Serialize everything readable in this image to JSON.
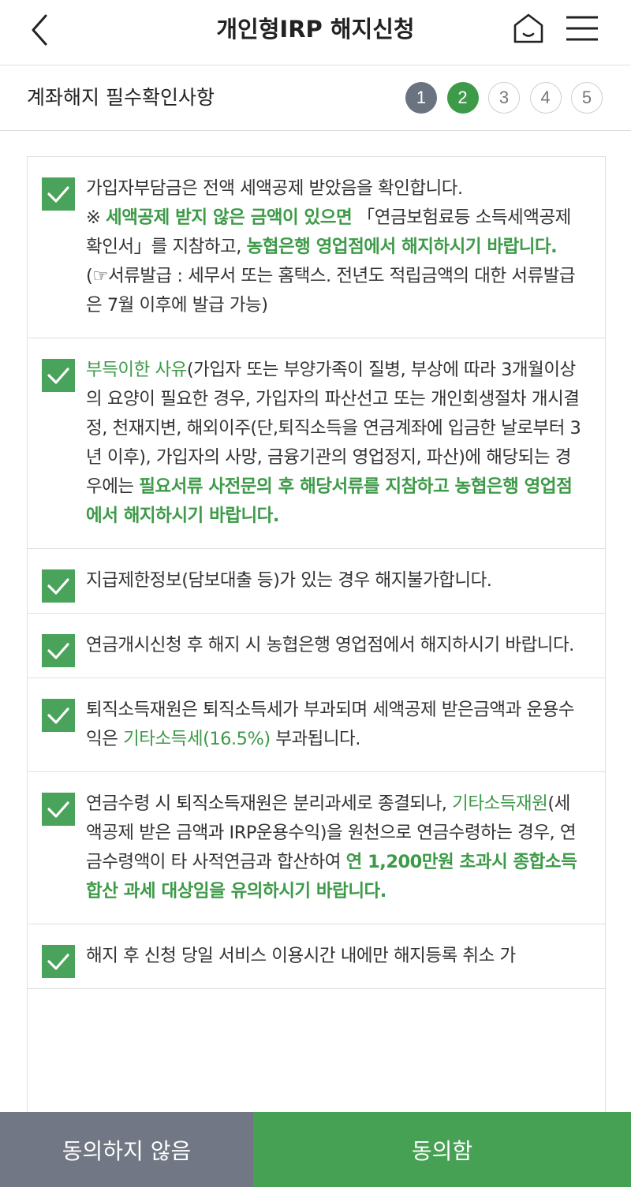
{
  "header": {
    "title": "개인형IRP 해지신청",
    "back_icon": "chevron-left-icon",
    "home_icon": "home-icon",
    "menu_icon": "hamburger-menu-icon"
  },
  "subheader": {
    "title": "계좌해지 필수확인사항",
    "steps": [
      "1",
      "2",
      "3",
      "4",
      "5"
    ],
    "current_step": 2
  },
  "colors": {
    "accent": "#3d9a48",
    "checkbox": "#4aa35a",
    "step_done": "#6b7380",
    "disagree_bg": "#717784",
    "agree_bg": "#46a155"
  },
  "items": [
    {
      "checked": true,
      "segments": [
        {
          "t": "가입자부담금은 전액 세액공제 받았음을 확인합니다."
        },
        {
          "br": true
        },
        {
          "t": "※ "
        },
        {
          "t": "세액공제 받지 않은 금액이 있으면",
          "g": true,
          "b": true
        },
        {
          "t": " 「연금보험료등 소득세액공제확인서」를 지참하고, "
        },
        {
          "t": "농협은행 영업점에서 해지하시기 바랍니다.",
          "g": true,
          "b": true
        },
        {
          "br": true
        },
        {
          "t": "(☞서류발급 : 세무서 또는 홈택스. 전년도 적립금액의 대한 서류발급은 7월 이후에 발급 가능)"
        }
      ]
    },
    {
      "checked": true,
      "segments": [
        {
          "t": "부득이한 사유",
          "g": true
        },
        {
          "t": "(가입자 또는 부양가족이 질병, 부상에 따라 3개월이상의 요양이 필요한 경우, 가입자의 파산선고 또는 개인회생절차 개시결정, 천재지변, 해외이주(단,퇴직소득을 연금계좌에 입금한 날로부터 3년 이후), 가입자의 사망, 금융기관의 영업정지, 파산)에 해당되는 경우에는 "
        },
        {
          "t": "필요서류 사전문의 후 해당서류를 지참하고 농협은행 영업점에서 해지하시기 바랍니다.",
          "g": true,
          "b": true
        }
      ]
    },
    {
      "checked": true,
      "segments": [
        {
          "t": "지급제한정보(담보대출 등)가 있는 경우 해지불가합니다."
        }
      ]
    },
    {
      "checked": true,
      "segments": [
        {
          "t": "연금개시신청 후 해지 시 농협은행 영업점에서 해지하시기 바랍니다."
        }
      ]
    },
    {
      "checked": true,
      "segments": [
        {
          "t": "퇴직소득재원은 퇴직소득세가 부과되며 세액공제 받은금액과 운용수익은 "
        },
        {
          "t": "기타소득세(16.5%)",
          "g": true
        },
        {
          "t": " 부과됩니다."
        }
      ]
    },
    {
      "checked": true,
      "segments": [
        {
          "t": "연금수령 시 퇴직소득재원은 분리과세로 종결되나, "
        },
        {
          "t": "기타소득재원",
          "g": true
        },
        {
          "t": "(세액공제 받은 금액과 IRP운용수익)을 원천으로 연금수령하는 경우, 연금수령액이 타 사적연금과 합산하여 "
        },
        {
          "t": "연 1,200만원 초과시 종합소득합산 과세 대상임을 유의하시기 바랍니다.",
          "g": true,
          "b": true
        }
      ]
    },
    {
      "checked": true,
      "segments": [
        {
          "t": "해지 후 신청 당일 서비스 이용시간 내에만 해지등록 취소 가"
        }
      ]
    }
  ],
  "footer": {
    "disagree_label": "동의하지 않음",
    "agree_label": "동의함"
  }
}
